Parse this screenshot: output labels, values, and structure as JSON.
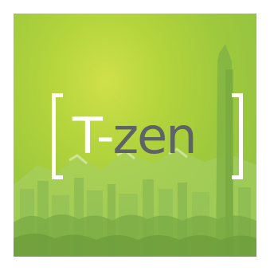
{
  "logo": {
    "prefix": "T-",
    "suffix": "zen",
    "brackets": [
      "[",
      "]"
    ]
  },
  "colors": {
    "background": "#ffffff",
    "tile_light": "#cfe04a",
    "tile_dark": "#8cbf45",
    "logo_white": "#ffffff",
    "logo_gray": "#5e6466"
  },
  "icons": {
    "background_scene": "city-skyline-with-mountains"
  }
}
